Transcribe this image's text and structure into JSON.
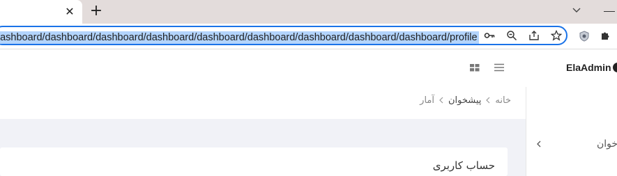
{
  "browser": {
    "address_url": "dashboard/dashboard/dashboard/dashboard/dashboard/dashboard/dashboard/dashboard/dashboard/profile",
    "tab_close_icon": "close-icon",
    "new_tab_icon": "plus-icon"
  },
  "app": {
    "logo_text": "ElaAdmin"
  },
  "breadcrumb": {
    "items": [
      "خانه",
      "پیشخوان",
      "آمار"
    ]
  },
  "sidebar": {
    "partial_label": "خوان"
  },
  "card": {
    "title": "حساب کاربری"
  },
  "colors": {
    "accent": "#1a73e8",
    "selection": "#b3d4fc",
    "page_bg": "#f1f2f7"
  }
}
